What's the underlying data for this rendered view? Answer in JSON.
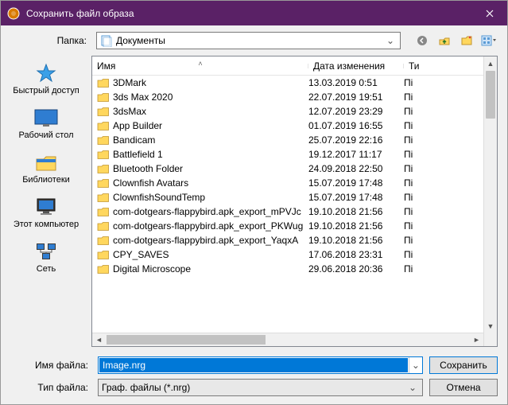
{
  "window": {
    "title": "Сохранить файл образа"
  },
  "toolbar": {
    "folder_label": "Папка:",
    "current_folder": "Документы"
  },
  "places": [
    {
      "id": "quick",
      "label": "Быстрый доступ"
    },
    {
      "id": "desktop",
      "label": "Рабочий стол"
    },
    {
      "id": "libraries",
      "label": "Библиотеки"
    },
    {
      "id": "thispc",
      "label": "Этот компьютер"
    },
    {
      "id": "network",
      "label": "Сеть"
    }
  ],
  "columns": {
    "name": "Имя",
    "date": "Дата изменения",
    "type": "Ти"
  },
  "rows": [
    {
      "name": "3DMark",
      "date": "13.03.2019 0:51",
      "type": "Пі"
    },
    {
      "name": "3ds Max 2020",
      "date": "22.07.2019 19:51",
      "type": "Пі"
    },
    {
      "name": "3dsMax",
      "date": "12.07.2019 23:29",
      "type": "Пі"
    },
    {
      "name": "App Builder",
      "date": "01.07.2019 16:55",
      "type": "Пі"
    },
    {
      "name": "Bandicam",
      "date": "25.07.2019 22:16",
      "type": "Пі"
    },
    {
      "name": "Battlefield 1",
      "date": "19.12.2017 11:17",
      "type": "Пі"
    },
    {
      "name": "Bluetooth Folder",
      "date": "24.09.2018 22:50",
      "type": "Пі"
    },
    {
      "name": "Clownfish Avatars",
      "date": "15.07.2019 17:48",
      "type": "Пі"
    },
    {
      "name": "ClownfishSoundTemp",
      "date": "15.07.2019 17:48",
      "type": "Пі"
    },
    {
      "name": "com-dotgears-flappybird.apk_export_mPVJc",
      "date": "19.10.2018 21:56",
      "type": "Пі"
    },
    {
      "name": "com-dotgears-flappybird.apk_export_PKWug",
      "date": "19.10.2018 21:56",
      "type": "Пі"
    },
    {
      "name": "com-dotgears-flappybird.apk_export_YaqxA",
      "date": "19.10.2018 21:56",
      "type": "Пі"
    },
    {
      "name": "CPY_SAVES",
      "date": "17.06.2018 23:31",
      "type": "Пі"
    },
    {
      "name": "Digital Microscope",
      "date": "29.06.2018 20:36",
      "type": "Пі"
    }
  ],
  "filename": {
    "label": "Имя файла:",
    "value": "Image.nrg"
  },
  "filetype": {
    "label": "Тип файла:",
    "value": "Граф. файлы (*.nrg)"
  },
  "buttons": {
    "save": "Сохранить",
    "cancel": "Отмена"
  }
}
